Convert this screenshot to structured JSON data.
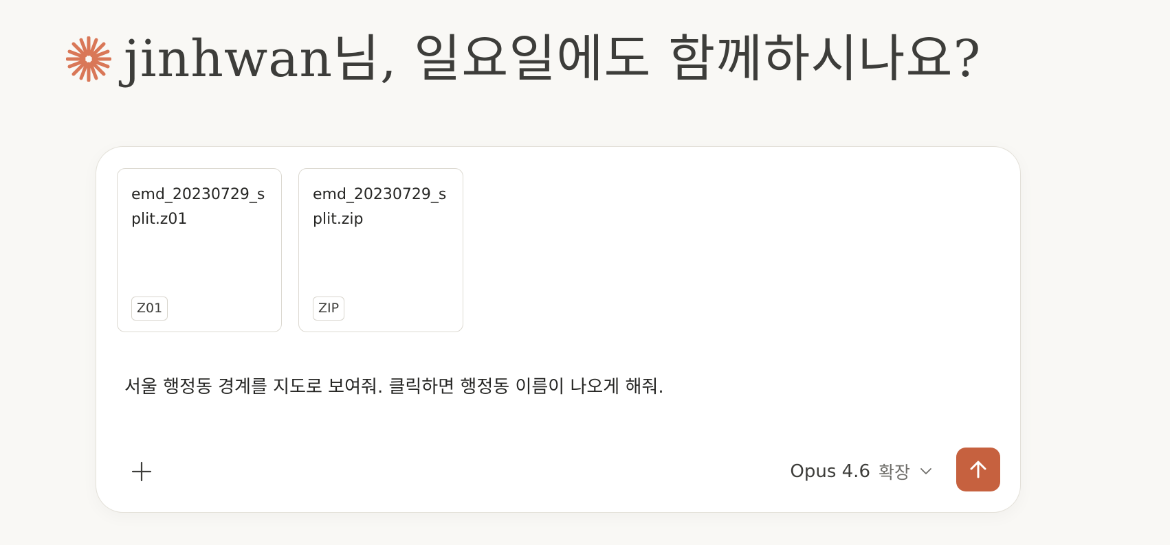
{
  "greeting": {
    "text": "jinhwan님, 일요일에도 함께하시나요?",
    "logo_icon": "claude-spark-icon"
  },
  "composer": {
    "attachments": [
      {
        "filename": "emd_20230729_split.z01",
        "badge": "Z01"
      },
      {
        "filename": "emd_20230729_split.zip",
        "badge": "ZIP"
      }
    ],
    "prompt": "서울 행정동 경계를 지도로 보여줘. 클릭하면 행정동 이름이 나오게 해줘.",
    "add_button_icon": "plus-icon",
    "model": {
      "name": "Opus 4.6",
      "mode": "확장",
      "icon": "chevron-down-icon"
    },
    "send_button_icon": "arrow-up-icon"
  },
  "colors": {
    "background": "#f9f8f5",
    "accent": "#c6613f",
    "spark": "#d97757",
    "text": "#3d3d3a"
  }
}
